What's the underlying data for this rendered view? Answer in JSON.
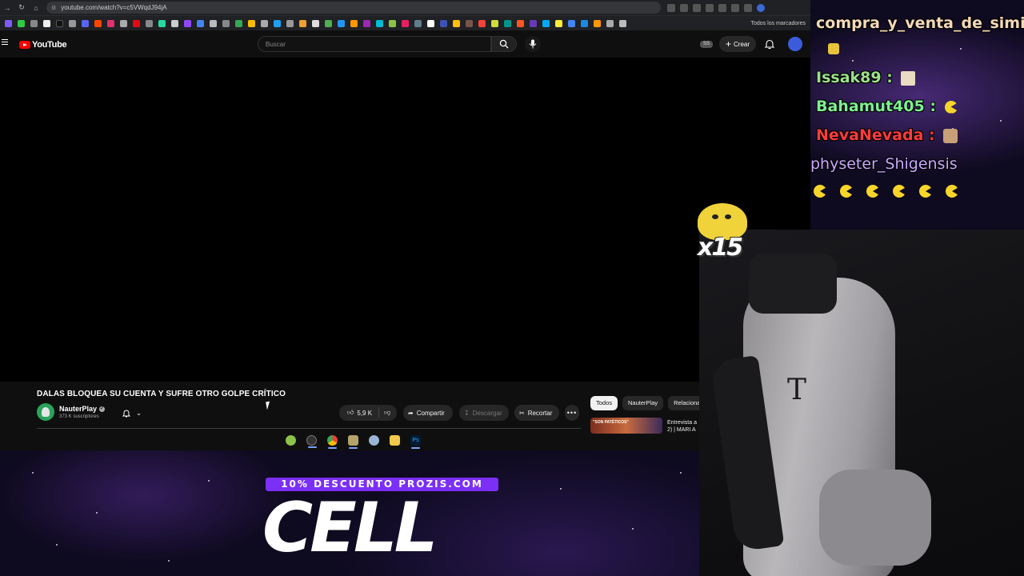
{
  "browser": {
    "url": "youtube.com/watch?v=c5VWqdJ94jA",
    "bookmarks_all_label": "Todos los marcadores"
  },
  "yt_header": {
    "logo_text": "YouTube",
    "search_placeholder": "Buscar",
    "badge": "SS",
    "create_label": "Crear"
  },
  "video": {
    "title": "DALAS BLOQUEA SU CUENTA Y SUFRE OTRO GOLPE CRÍTICO",
    "channel_name": "NauterPlay",
    "subscribers": "373 K suscriptores",
    "likes": "5,9 K",
    "share_label": "Compartir",
    "download_label": "Descargar",
    "clip_label": "Recortar",
    "more_label": "•••"
  },
  "sidebar": {
    "chips": [
      {
        "label": "Todos",
        "active": true
      },
      {
        "label": "NauterPlay",
        "active": false
      },
      {
        "label": "Relacionad",
        "active": false
      }
    ],
    "related_thumb_text": "\"SON PATÉTICOS\"",
    "related_title": "Entrevista a 2) | MARI A"
  },
  "chat": {
    "messages": [
      {
        "user": "compra_y_venta_de_simios",
        "color": "#f5d9b8"
      },
      {
        "user": "Issak89",
        "separator": ":",
        "color": "#9be28a"
      },
      {
        "user": "Bahamut405",
        "separator": ":",
        "color": "#7ef08f"
      },
      {
        "user": "NevaNevada",
        "separator": ":",
        "color": "#ff3b3b"
      },
      {
        "user": "physeter_Shigensis",
        "color": "#c9a8ff"
      }
    ],
    "combo_count": "x15"
  },
  "promo": {
    "discount": "10% DESCUENTO PROZIS.COM",
    "code": "CELL"
  },
  "colors": {
    "yt_red": "#ff0000",
    "promo_purple": "#7b2ff7",
    "yt_bg": "#0f0f0f"
  }
}
